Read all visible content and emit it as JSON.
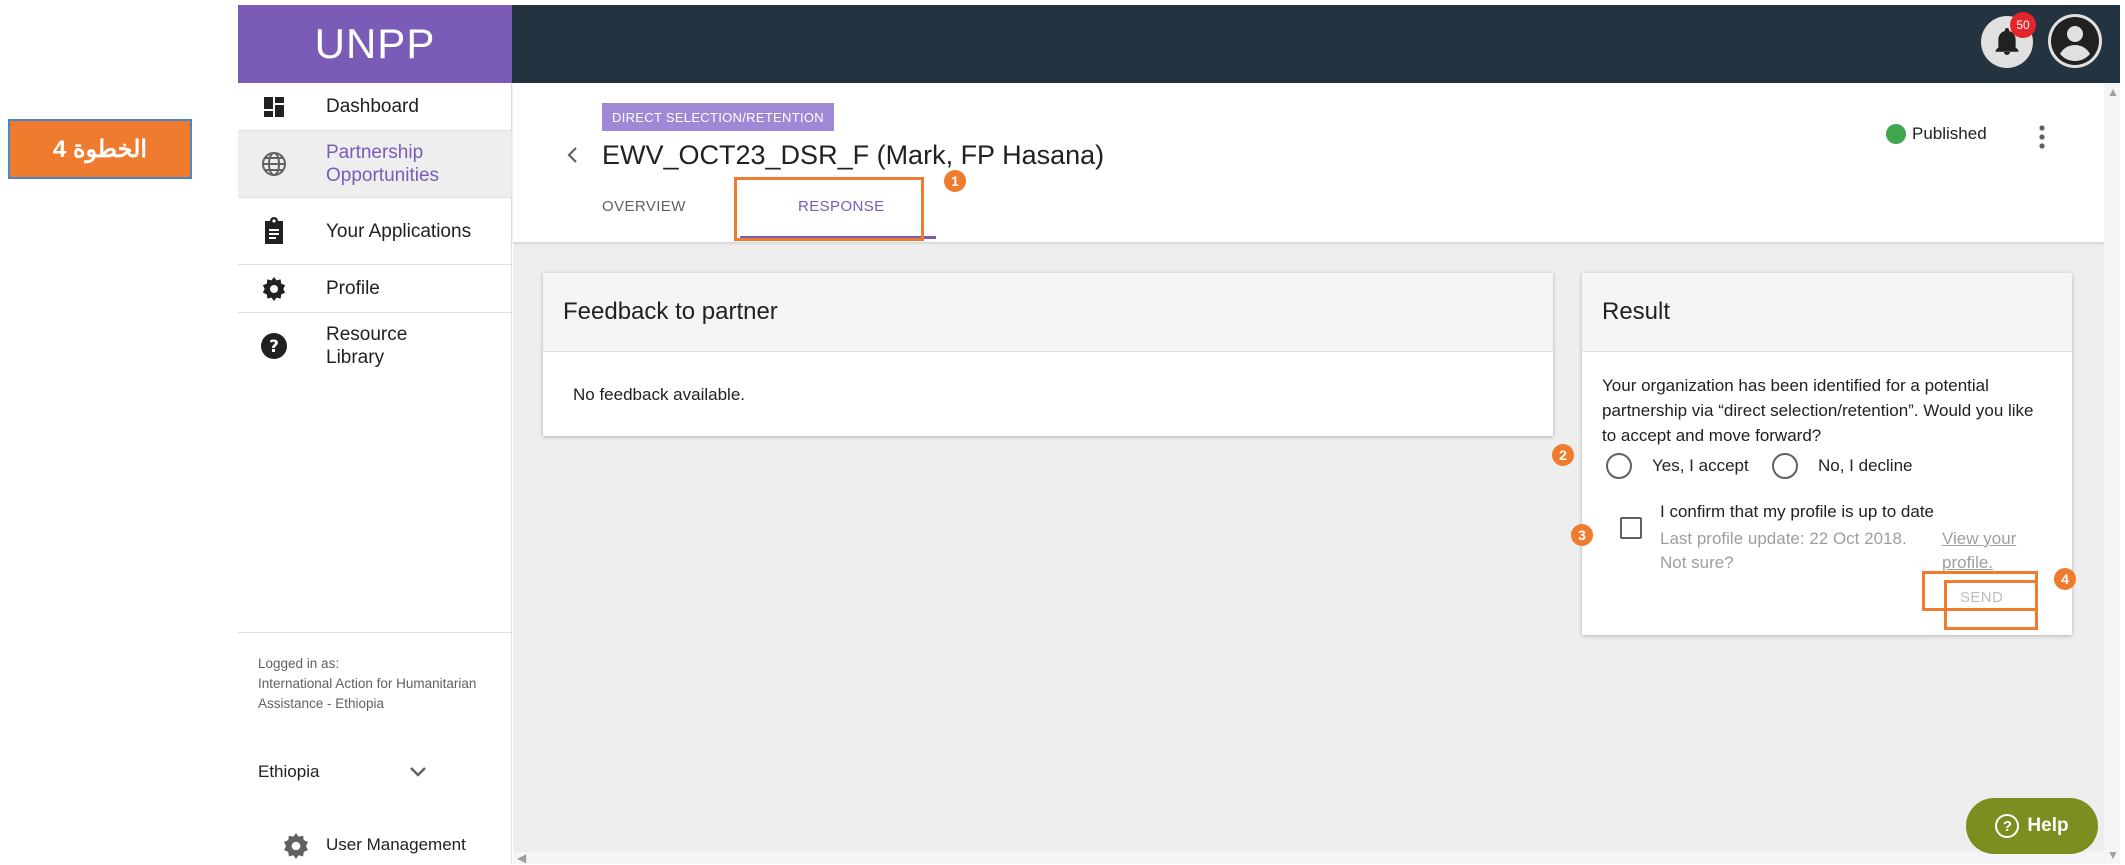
{
  "step_badge": {
    "label": "الخطوة 4"
  },
  "app": {
    "logo": "UNPP",
    "notification_count": "50"
  },
  "sidebar": {
    "items": [
      {
        "label": "Dashboard",
        "icon": "dashboard-icon"
      },
      {
        "label": "Partnership Opportunities",
        "icon": "globe-icon",
        "active": true
      },
      {
        "label": "Your Applications",
        "icon": "clipboard-icon"
      },
      {
        "label": "Profile",
        "icon": "gear-icon"
      },
      {
        "label": "Resource Library",
        "icon": "help-circle-icon"
      }
    ],
    "logged_in_label": "Logged in as:",
    "organization": "International Action for Humanitarian Assistance - Ethiopia",
    "country": "Ethiopia",
    "user_management": "User Management"
  },
  "header": {
    "type_chip": "DIRECT SELECTION/RETENTION",
    "title": "EWV_OCT23_DSR_F (Mark, FP Hasana)",
    "status": "Published",
    "status_color": "#3fa64f",
    "tabs": [
      {
        "label": "OVERVIEW"
      },
      {
        "label": "RESPONSE",
        "active": true
      }
    ]
  },
  "feedback_card": {
    "title": "Feedback to partner",
    "empty_text": "No feedback available."
  },
  "result_card": {
    "title": "Result",
    "question": "Your organization has been identified for a potential partnership via “direct selection/retention”. Would you like to accept and move forward?",
    "accept_label": "Yes, I accept",
    "decline_label": "No, I decline",
    "confirm_label": "I confirm that my profile is up to date",
    "last_update": "Last profile update: 22 Oct 2018. Not sure?",
    "view_profile_link": "View your profile.",
    "send_label": "SEND"
  },
  "help": {
    "label": "Help"
  },
  "markers": [
    "1",
    "2",
    "3",
    "4"
  ],
  "colors": {
    "brand": "#7a5cb8",
    "topbar": "#233340",
    "highlight": "#ef7b2e",
    "help": "#7a8f1f"
  }
}
